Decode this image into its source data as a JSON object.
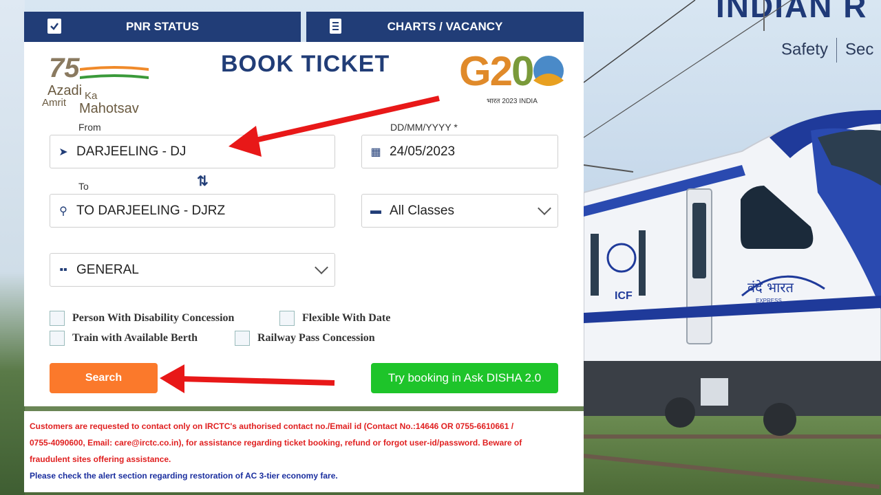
{
  "tabs": [
    {
      "label": "PNR STATUS",
      "icon": "clipboard-check-icon"
    },
    {
      "label": "CHARTS / VACANCY",
      "icon": "document-list-icon"
    }
  ],
  "brand": {
    "title": "INDIAN R",
    "tagline_1": "Safety",
    "tagline_2": "Sec"
  },
  "logo_azadi": {
    "number": "75",
    "line1": "Azadi",
    "line2": "Ka",
    "line3": "Amrit",
    "line4": "Mahotsav"
  },
  "logo_g20": {
    "text_g": "G2",
    "text_zero": "0",
    "sub": "भारत 2023 INDIA"
  },
  "form": {
    "title": "BOOK TICKET",
    "from_label": "From",
    "from_value": "DARJEELING - DJ",
    "date_label": "DD/MM/YYYY *",
    "date_value": "24/05/2023",
    "to_label": "To",
    "to_value": "TO DARJEELING - DJRZ",
    "class_value": "All Classes",
    "quota_value": "GENERAL",
    "checkboxes": [
      {
        "label": "Person With Disability Concession",
        "checked": false
      },
      {
        "label": "Flexible With Date",
        "checked": false
      },
      {
        "label": "Train with Available Berth",
        "checked": false
      },
      {
        "label": "Railway Pass Concession",
        "checked": false
      }
    ],
    "search_label": "Search",
    "disha_label": "Try booking in Ask DISHA 2.0"
  },
  "notice": {
    "line1": "Customers are requested to contact only on IRCTC's authorised contact no./Email id (Contact No.:14646 OR 0755-6610661 /",
    "line2": "0755-4090600, Email: care@irctc.co.in), for assistance regarding ticket booking, refund or forgot user-id/password. Beware of",
    "line3": "fraudulent sites offering assistance.",
    "line4": "Please check the alert section regarding restoration of AC 3-tier economy fare."
  },
  "train": {
    "emblem_text": "ICF",
    "name_text": "वंदे भारत",
    "sub_text": "EXPRESS"
  },
  "colors": {
    "navy": "#213d77",
    "orange": "#fb792b",
    "green": "#1ec42a",
    "notice_red": "#e02020",
    "notice_blue": "#1a2e9e",
    "arrow_red": "#e81818"
  }
}
